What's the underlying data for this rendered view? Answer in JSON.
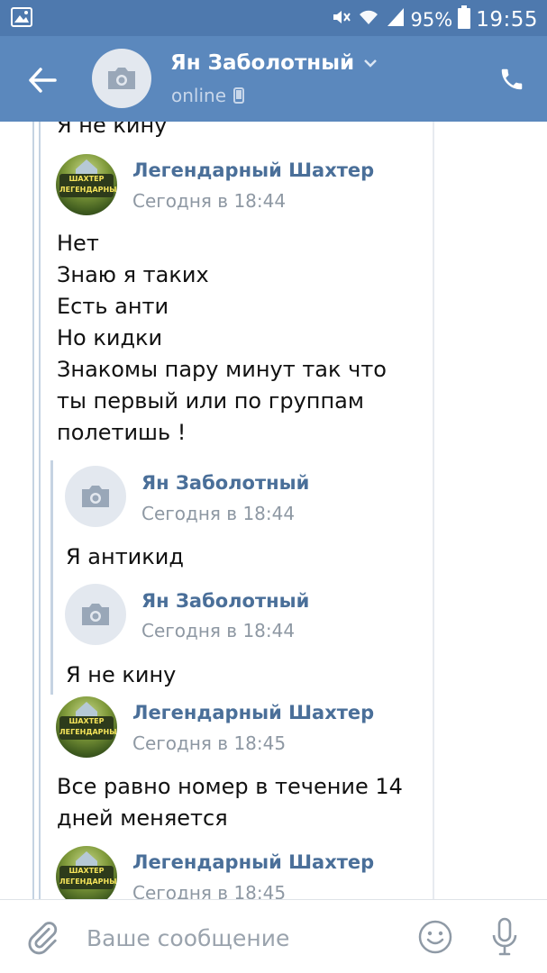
{
  "status_bar": {
    "battery": "95%",
    "clock": "19:55",
    "icons": [
      "image-icon",
      "mute-icon",
      "wifi-icon",
      "signal-icon",
      "battery-icon"
    ]
  },
  "header": {
    "contact_name": "Ян Заболотный",
    "presence": "online",
    "icons": [
      "back-arrow-icon",
      "camera-placeholder-icon",
      "chevron-down-icon",
      "phone-device-icon",
      "phone-call-icon"
    ]
  },
  "chat": {
    "top_partial_text": "Я не кину",
    "messages": [
      {
        "author": "Легендарный Шахтер",
        "time": "Сегодня в 18:44",
        "lines": [
          "Нет",
          "Знаю я таких",
          "Есть анти",
          "Но кидки",
          "Знакомы пару минут так что",
          "ты первый или по группам",
          "полетишь !"
        ]
      },
      {
        "author": "Ян Заболотный",
        "time": "Сегодня в 18:44",
        "lines": [
          "Я антикид"
        ]
      },
      {
        "author": "Ян Заболотный",
        "time": "Сегодня в 18:44",
        "lines": [
          "Я не кину"
        ]
      },
      {
        "author": "Легендарный Шахтер",
        "time": "Сегодня в 18:45",
        "lines": [
          "Все равно номер в течение 14",
          "дней меняется"
        ]
      },
      {
        "author": "Легендарный Шахтер",
        "time": "Сегодня в 18:45",
        "lines": []
      }
    ],
    "avatar_badge": [
      "ШАХТЕР",
      "ЛЕГЕНДАРНЫЙ"
    ]
  },
  "compose": {
    "placeholder": "Ваше сообщение",
    "icons": [
      "paperclip-icon",
      "smiley-icon",
      "microphone-icon"
    ]
  },
  "colors": {
    "status_bar": "#4e79ae",
    "header": "#5b88bd",
    "author_link": "#4a6f99",
    "timestamp": "#8e98a3",
    "quote_line": "#c5d3e2"
  }
}
